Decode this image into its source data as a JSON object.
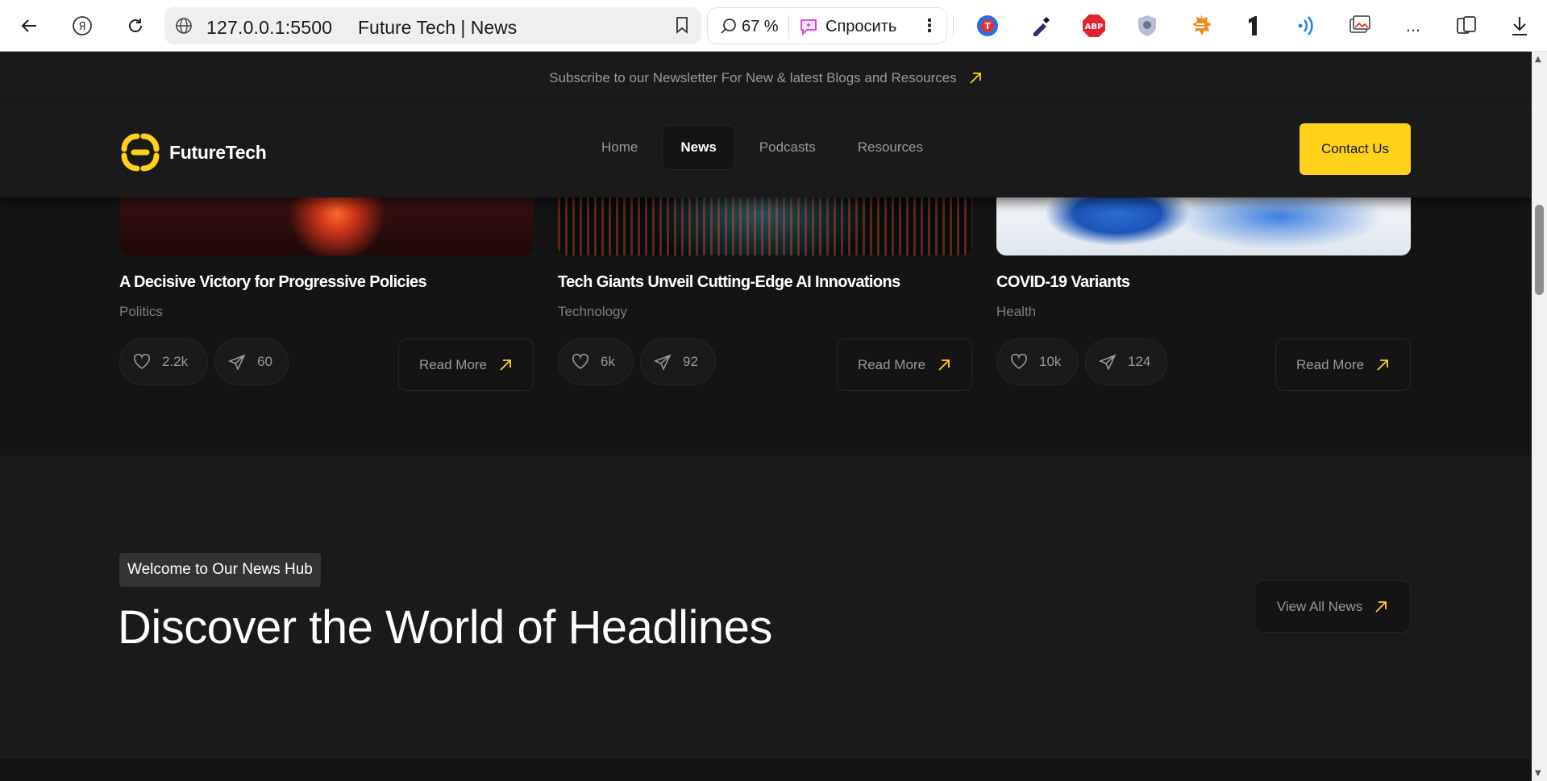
{
  "browser": {
    "url": "127.0.0.1:5500",
    "tab_title": "Future Tech | News",
    "zoom": "67 %",
    "ask_label": "Спросить",
    "more_label": "..."
  },
  "newsletter": {
    "text": "Subscribe to our Newsletter For New & latest Blogs and Resources"
  },
  "nav": {
    "brand": "FutureTech",
    "links": [
      "Home",
      "News",
      "Podcasts",
      "Resources"
    ],
    "active": "News",
    "contact": "Contact Us"
  },
  "cards": [
    {
      "title": "A Decisive Victory for Progressive Policies",
      "category": "Politics",
      "likes": "2.2k",
      "shares": "60",
      "read_more": "Read More"
    },
    {
      "title": "Tech Giants Unveil Cutting-Edge AI Innovations",
      "category": "Technology",
      "likes": "6k",
      "shares": "92",
      "read_more": "Read More"
    },
    {
      "title": "COVID-19 Variants",
      "category": "Health",
      "likes": "10k",
      "shares": "124",
      "read_more": "Read More"
    }
  ],
  "headlines": {
    "tag": "Welcome to Our News Hub",
    "title": "Discover the World of Headlines",
    "view_all": "View All News"
  },
  "colors": {
    "accent": "#ffd11a",
    "bg_dark": "#141414",
    "bg_section": "#1a1a1a",
    "text_muted": "#98989a"
  }
}
